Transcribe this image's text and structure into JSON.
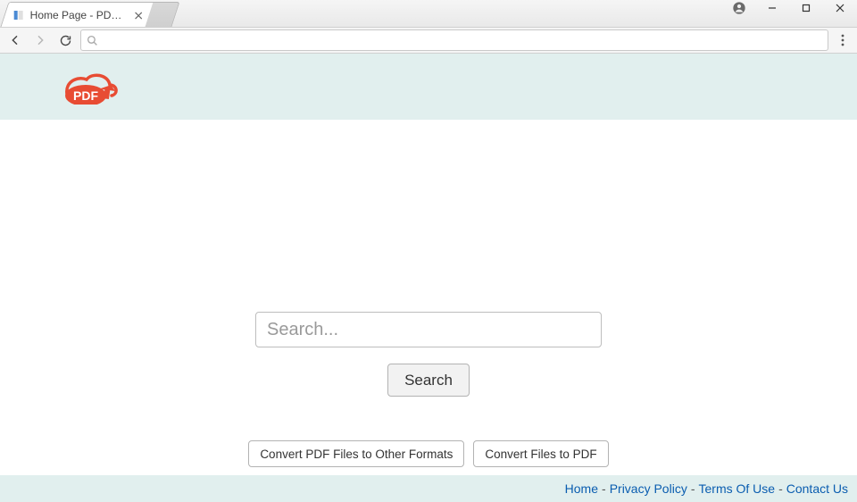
{
  "window": {
    "title": ""
  },
  "browser": {
    "tab": {
      "title": "Home Page - PDF Conve"
    },
    "omnibox": {
      "value": ""
    }
  },
  "logo": {
    "text": "PDF"
  },
  "search": {
    "placeholder": "Search...",
    "value": "",
    "button_label": "Search"
  },
  "convert": {
    "to_other_label": "Convert PDF Files to Other Formats",
    "to_pdf_label": "Convert Files to PDF"
  },
  "footer": {
    "home": "Home",
    "privacy": "Privacy Policy",
    "terms": "Terms Of Use",
    "contact": "Contact Us",
    "sep": "-"
  }
}
